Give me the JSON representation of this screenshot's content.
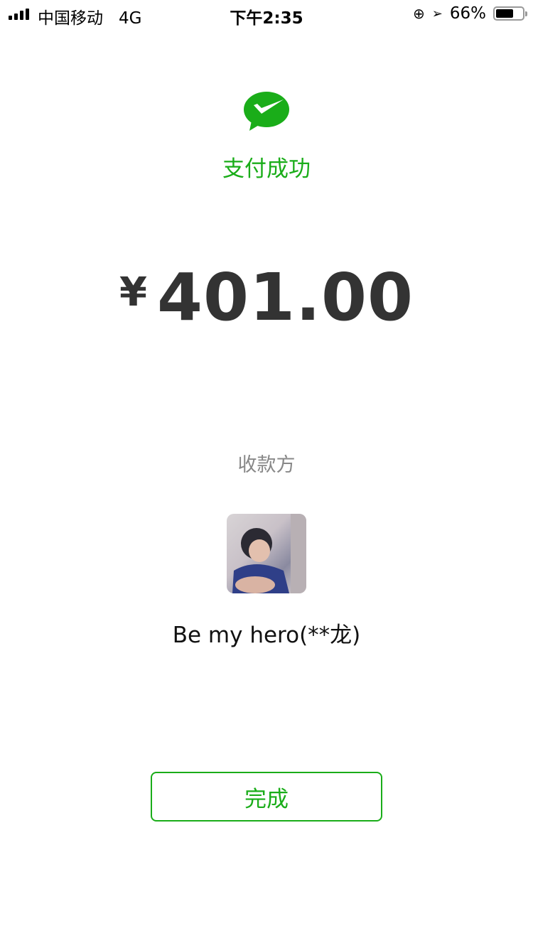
{
  "status_bar": {
    "carrier": "中国移动",
    "network": "4G",
    "time": "下午2:35",
    "battery": "66%",
    "battery_level": 0.66
  },
  "result": {
    "title": "支付成功",
    "currency": "¥",
    "amount": "401.00"
  },
  "payee": {
    "label": "收款方",
    "name": "Be my hero(**龙)"
  },
  "done_label": "完成",
  "colors": {
    "accent": "#1aad19",
    "amount": "#333333"
  }
}
